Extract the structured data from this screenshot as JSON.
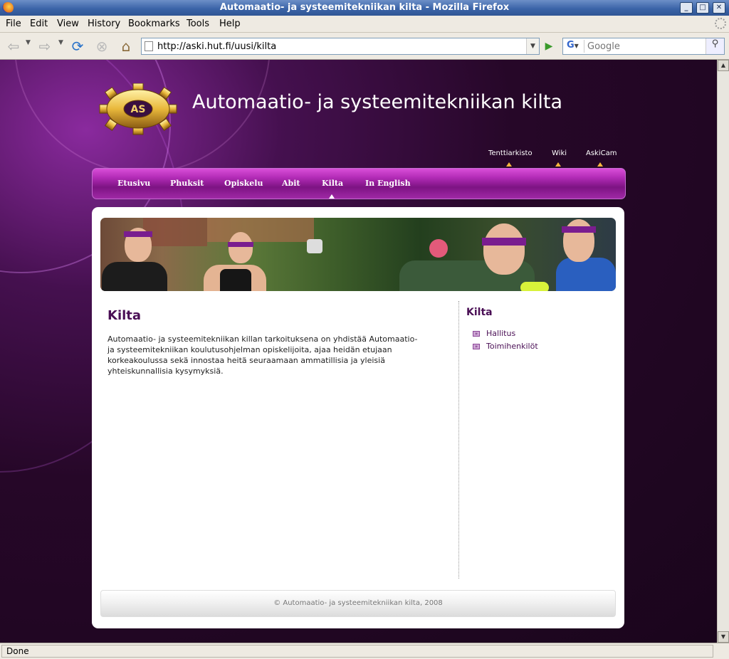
{
  "window": {
    "title": "Automaatio- ja systeemitekniikan kilta - Mozilla Firefox",
    "buttons": [
      "_",
      "□",
      "✕"
    ]
  },
  "menu": [
    "File",
    "Edit",
    "View",
    "History",
    "Bookmarks",
    "Tools",
    "Help"
  ],
  "toolbar": {
    "url": "http://aski.hut.fi/uusi/kilta",
    "search_placeholder": "Google",
    "search_engine": "G"
  },
  "site": {
    "logo_text": "AS",
    "title": "Automaatio- ja systeemitekniikan kilta",
    "top_links": [
      "Tenttiarkisto",
      "Wiki",
      "AskiCam"
    ],
    "nav": [
      "Etusivu",
      "Phuksit",
      "Opiskelu",
      "Abit",
      "Kilta",
      "In English"
    ],
    "active_nav": "Kilta"
  },
  "main": {
    "heading": "Kilta",
    "body": "Automaatio- ja systeemitekniikan killan tarkoituksena on yhdistää Automaatio- ja systeemitekniikan koulutusohjelman opiskelijoita, ajaa heidän etujaan korkeakoulussa sekä innostaa heitä seuraamaan ammatillisia ja yleisiä yhteiskunnallisia kysymyksiä."
  },
  "sidebar": {
    "heading": "Kilta",
    "items": [
      "Hallitus",
      "Toimihenkilöt"
    ]
  },
  "footer": {
    "text": "© Automaatio- ja systeemitekniikan kilta, 2008"
  },
  "status": {
    "text": "Done"
  },
  "colors": {
    "accent": "#4a0f55",
    "nav_bg": "#a029a6",
    "page_bg": "#260728"
  }
}
